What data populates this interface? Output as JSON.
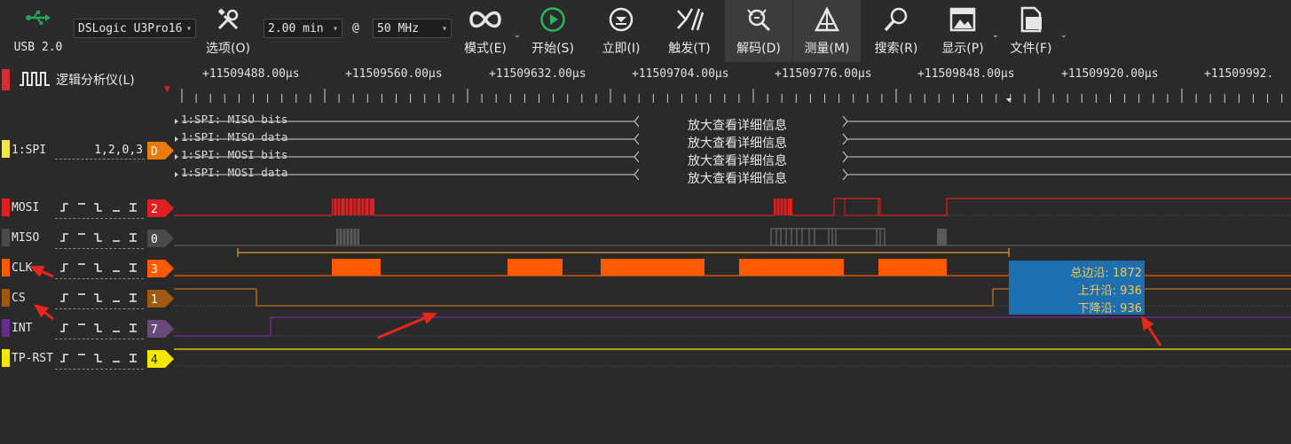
{
  "toolbar": {
    "device_label": "USB 2.0",
    "device_select": "DSLogic U3Pro16",
    "options_label": "选项(O)",
    "duration_select": "2.00 min",
    "at_symbol": "@",
    "rate_select": "50 MHz",
    "mode_label": "模式(E)",
    "start_label": "开始(S)",
    "instant_label": "立即(I)",
    "trigger_label": "触发(T)",
    "decode_label": "解码(D)",
    "measure_label": "测量(M)",
    "search_label": "搜索(R)",
    "display_label": "显示(P)",
    "file_label": "文件(F)"
  },
  "header": {
    "title": "逻辑分析仪(L)",
    "title_color": "#d32f2f",
    "ticks": [
      "+11509488.00μs",
      "+11509560.00μs",
      "+11509632.00μs",
      "+11509704.00μs",
      "+11509776.00μs",
      "+11509848.00μs",
      "+11509920.00μs",
      "+11509992."
    ]
  },
  "decoder": {
    "name": "1:SPI",
    "config": "1,2,0,3",
    "tag": "D",
    "color": "#f5e642",
    "rows": [
      {
        "label": "1:SPI: MISO bits",
        "info": "放大查看详细信息"
      },
      {
        "label": "1:SPI: MISO data",
        "info": "放大查看详细信息"
      },
      {
        "label": "1:SPI: MOSI bits",
        "info": "放大查看详细信息"
      },
      {
        "label": "1:SPI: MOSI data",
        "info": "放大查看详细信息"
      }
    ]
  },
  "channels": [
    {
      "name": "MOSI",
      "index": "2",
      "color": "#e02020"
    },
    {
      "name": "MISO",
      "index": "0",
      "color": "#4a4a4a"
    },
    {
      "name": "CLK",
      "index": "3",
      "color": "#ff5a00"
    },
    {
      "name": "CS",
      "index": "1",
      "color": "#a05a10"
    },
    {
      "name": "INT",
      "index": "7",
      "color": "#6a2a8a"
    },
    {
      "name": "TP-RST",
      "index": "4",
      "color": "#f5e600"
    }
  ],
  "trigger_glyphs": [
    "_⌐",
    "¯",
    "⌐_",
    "_",
    "⌶"
  ],
  "measurement": {
    "total_edges": "总边沿: 1872",
    "rising_edges": "上升沿: 936",
    "falling_edges": "下降沿: 936"
  }
}
